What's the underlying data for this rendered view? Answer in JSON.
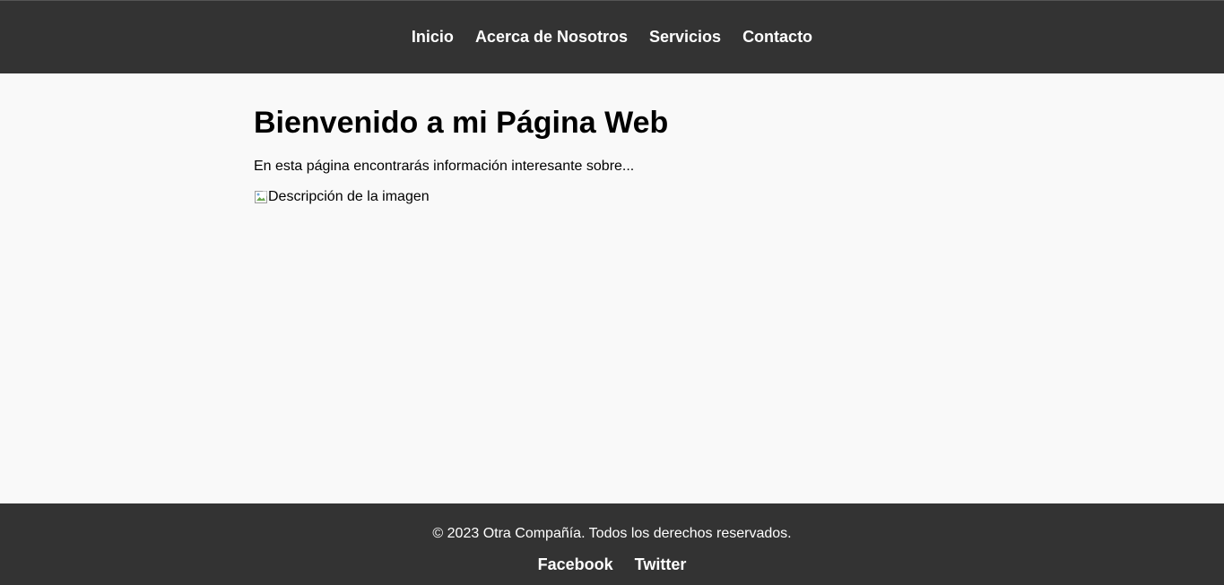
{
  "nav": {
    "items": [
      {
        "label": "Inicio"
      },
      {
        "label": "Acerca de Nosotros"
      },
      {
        "label": "Servicios"
      },
      {
        "label": "Contacto"
      }
    ]
  },
  "main": {
    "heading": "Bienvenido a mi Página Web",
    "intro": "En esta página encontrarás información interesante sobre...",
    "image_alt": "Descripción de la imagen"
  },
  "footer": {
    "copyright": "© 2023 Otra Compañía. Todos los derechos reservados.",
    "social": [
      {
        "label": "Facebook"
      },
      {
        "label": "Twitter"
      }
    ]
  },
  "colors": {
    "header_bg": "#333333",
    "footer_bg": "#333333",
    "page_bg": "#f9f9f9",
    "nav_text": "#ffffff"
  }
}
